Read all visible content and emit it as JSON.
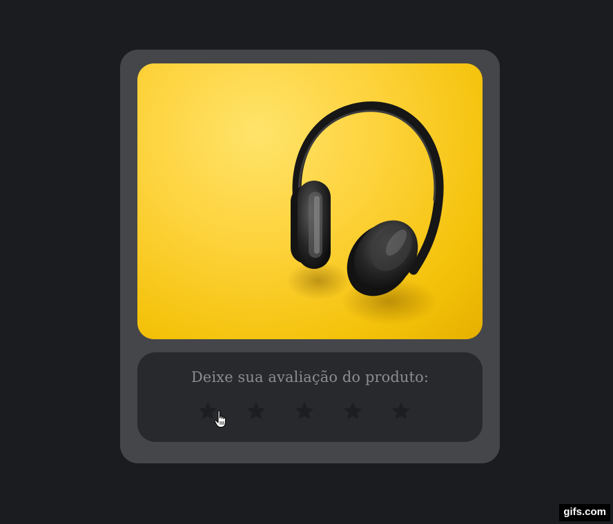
{
  "card": {
    "image": {
      "subject": "headphones",
      "background_color": "#fdd23a"
    },
    "rating": {
      "label": "Deixe sua avaliação do produto:",
      "max_stars": 5,
      "selected": 0,
      "star_color": "#1d1e21"
    }
  },
  "watermark": "gifs.com",
  "colors": {
    "page_background": "#1b1c20",
    "card_background": "#45464a",
    "panel_background": "#28292c",
    "label_color": "#8c8d91"
  }
}
